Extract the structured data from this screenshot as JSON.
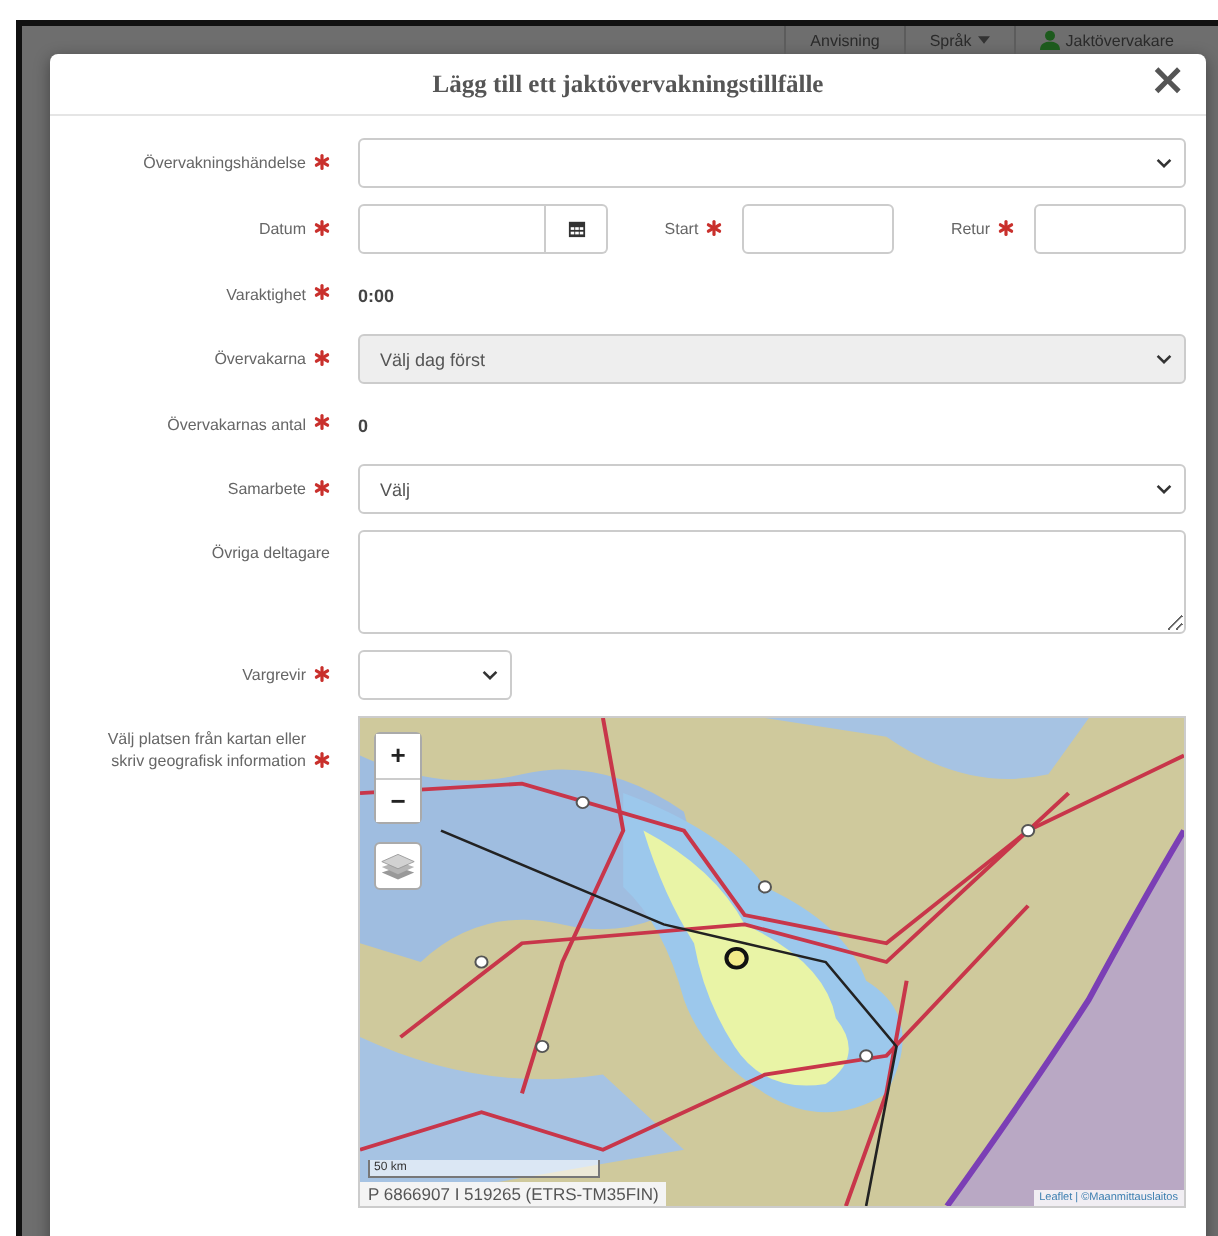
{
  "header": {
    "items": [
      {
        "label": "Anvisning",
        "kind": "link"
      },
      {
        "label": "Språk",
        "kind": "dropdown"
      },
      {
        "label": "Jaktövervakare",
        "kind": "user"
      }
    ]
  },
  "modal": {
    "title": "Lägg till ett jaktövervakningstillfälle",
    "close": "×",
    "fields": [
      {
        "kind": "select",
        "label": "Övervakningshändelse",
        "required": true,
        "disabled": false,
        "compact": false
      },
      {
        "kind": "date",
        "label": "Datum",
        "required": true,
        "extra": [
          {
            "label": "Start",
            "required": true
          },
          {
            "label": "Retur",
            "required": true
          }
        ]
      },
      {
        "kind": "readout",
        "label": "Varaktighet",
        "required": true,
        "value": "0:00"
      },
      {
        "kind": "select",
        "label": "Övervakarna",
        "required": true,
        "value": "Välj dag först",
        "disabled": true,
        "compact": false
      },
      {
        "kind": "readout",
        "label": "Övervakarnas antal",
        "required": true,
        "value": "0"
      },
      {
        "kind": "select",
        "label": "Samarbete",
        "required": true,
        "value": "Välj",
        "disabled": false,
        "compact": false
      },
      {
        "kind": "textarea",
        "label": "Övriga deltagare",
        "required": false
      },
      {
        "kind": "select",
        "label": "Vargrevir",
        "required": true,
        "disabled": false,
        "compact": true
      },
      {
        "kind": "map",
        "label": "Välj platsen från kartan eller skriv geografisk information",
        "required": true,
        "map": {
          "zoom_in": "+",
          "zoom_out": "−",
          "scale": "50 km",
          "coordinates": "P 6866907 I 519265 (ETRS-TM35FIN)",
          "attribution": "Leaflet | ©Maanmittauslaitos"
        }
      }
    ]
  }
}
